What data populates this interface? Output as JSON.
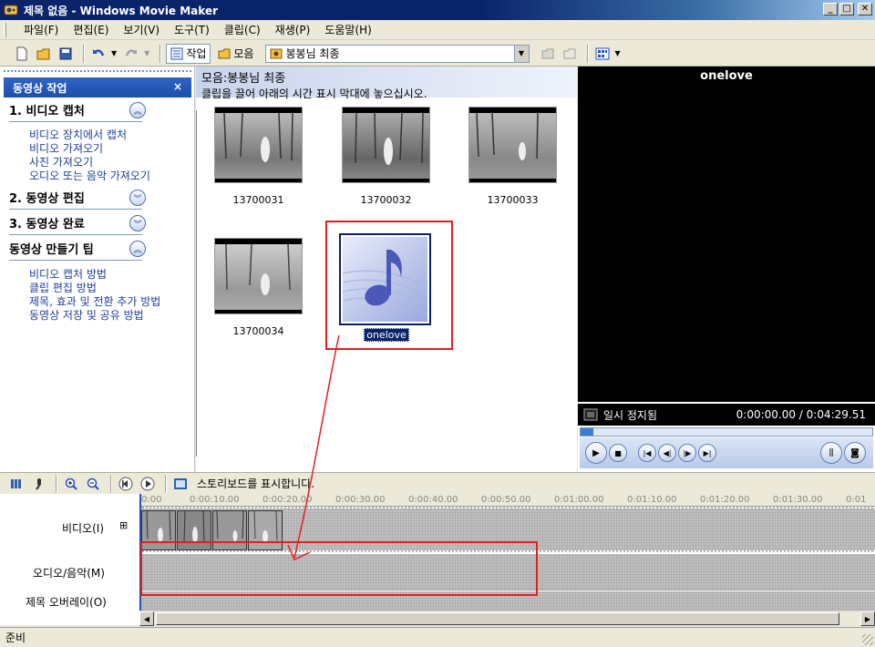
{
  "window": {
    "title": "제목 없음 - Windows Movie Maker"
  },
  "menu": [
    "파일(F)",
    "편집(E)",
    "보기(V)",
    "도구(T)",
    "클립(C)",
    "재생(P)",
    "도움말(H)"
  ],
  "toolbar": {
    "tasks_label": "작업",
    "collections_label": "모음",
    "collection_value": "봉봉님 최종"
  },
  "taskpane": {
    "title": "동영상 작업",
    "sections": [
      {
        "label": "1. 비디오 캡처",
        "links": [
          "비디오 장치에서 캡처",
          "비디오 가져오기",
          "사진 가져오기",
          "오디오 또는 음악 가져오기"
        ]
      },
      {
        "label": "2. 동영상 편집",
        "links": []
      },
      {
        "label": "3. 동영상 완료",
        "links": []
      },
      {
        "label": "동영상 만들기 팁",
        "links": [
          "비디오 캡처 방법",
          "클립 편집 방법",
          "제목, 효과 및 전환 추가 방법",
          "동영상 저장 및 공유 방법"
        ]
      }
    ]
  },
  "collection": {
    "title": "모음:봉봉님 최종",
    "subtitle": "클립을 끌어 아래의 시간 표시 막대에 놓으십시오.",
    "clips": [
      {
        "name": "13700031",
        "kind": "video"
      },
      {
        "name": "13700032",
        "kind": "video"
      },
      {
        "name": "13700033",
        "kind": "video"
      },
      {
        "name": "13700034",
        "kind": "video"
      },
      {
        "name": "onelove",
        "kind": "audio",
        "selected": true
      }
    ]
  },
  "monitor": {
    "title": "onelove",
    "status": "일시 정지됨",
    "time": "0:00:00.00 / 0:04:29.51"
  },
  "timeline": {
    "toolbar_label": "스토리보드를 표시합니다.",
    "tracks": {
      "video": "비디오(I)",
      "audio": "오디오/음악(M)",
      "overlay": "제목 오버레이(O)"
    },
    "ruler": [
      "0:00",
      "0:00:10.00",
      "0:00:20.00",
      "0:00:30.00",
      "0:00:40.00",
      "0:00:50.00",
      "0:01:00.00",
      "0:01:10.00",
      "0:01:20.00",
      "0:01:30.00",
      "0:01"
    ]
  },
  "statusbar": {
    "text": "준비"
  },
  "colors": {
    "titlebar": "#0a246a",
    "taskpane_header": "#2f63c8",
    "annotation": "#e02020"
  }
}
